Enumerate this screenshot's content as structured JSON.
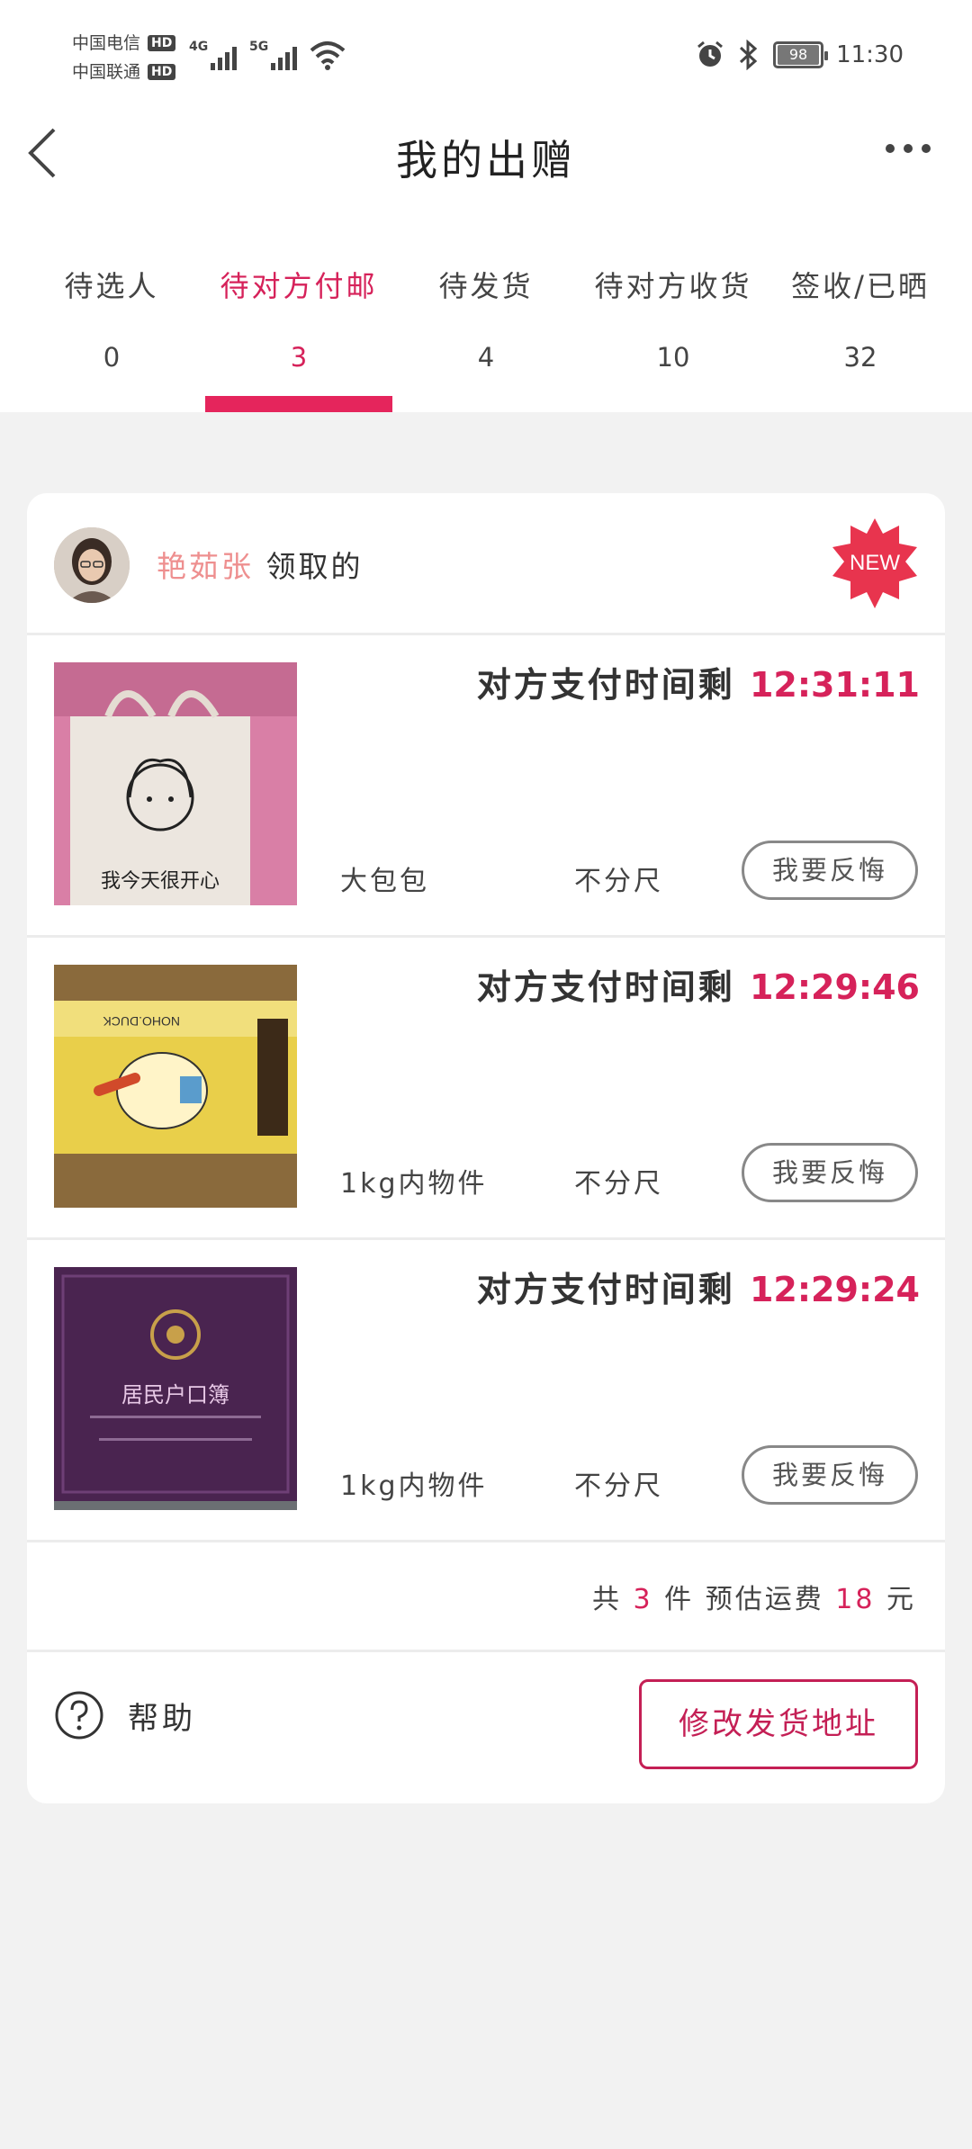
{
  "status_bar": {
    "carrier1": "中国电信",
    "carrier2": "中国联通",
    "hd": "HD",
    "net1": "4G",
    "net2": "5G",
    "battery": "98",
    "time": "11:30"
  },
  "header": {
    "title": "我的出赠"
  },
  "tabs": [
    {
      "label": "待选人",
      "count": "0"
    },
    {
      "label": "待对方付邮",
      "count": "3"
    },
    {
      "label": "待发货",
      "count": "4"
    },
    {
      "label": "待对方收货",
      "count": "10"
    },
    {
      "label": "签收/已晒",
      "count": "32"
    }
  ],
  "active_tab": 1,
  "claim": {
    "name": "艳茹张",
    "suffix": "领取的",
    "badge": "NEW"
  },
  "countdown_prefix": "对方支付时间剩",
  "items": [
    {
      "time": "12:31:11",
      "name": "大包包",
      "size": "不分尺",
      "button": "我要反悔",
      "thumb_text": "我今天很开心"
    },
    {
      "time": "12:29:46",
      "name": "1kg内物件",
      "size": "不分尺",
      "button": "我要反悔",
      "thumb_text": "NOHO.DUCK"
    },
    {
      "time": "12:29:24",
      "name": "1kg内物件",
      "size": "不分尺",
      "button": "我要反悔",
      "thumb_text": "居民户口簿"
    }
  ],
  "summary": {
    "prefix": "共",
    "count": "3",
    "mid": "件 预估运费",
    "fee": "18",
    "suffix": "元"
  },
  "footer": {
    "help": "帮助",
    "change_address": "修改发货地址"
  },
  "colors": {
    "accent": "#d6225a",
    "claimer": "#ee8f8f",
    "badge": "#e8344e"
  }
}
